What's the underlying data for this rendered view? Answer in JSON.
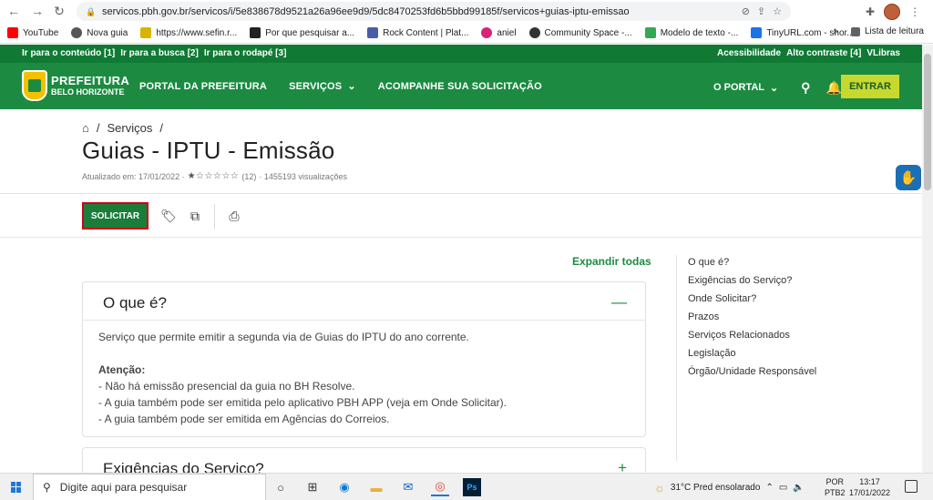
{
  "browser": {
    "url": "servicos.pbh.gov.br/servicos/i/5e838678d9521a26a96ee9d9/5dc8470253fd6b5bbd99185f/servicos+guias-iptu-emissao",
    "bookmarks": [
      {
        "label": "YouTube",
        "color": "#ff0000"
      },
      {
        "label": "Nova guia",
        "color": "#555555"
      },
      {
        "label": "https://www.sefin.r...",
        "color": "#d9b300"
      },
      {
        "label": "Por que pesquisar a...",
        "color": "#222222"
      },
      {
        "label": "Rock Content | Plat...",
        "color": "#4a5ca8"
      },
      {
        "label": "aniel",
        "color": "#d6247a"
      },
      {
        "label": "Community Space -...",
        "color": "#333333"
      },
      {
        "label": "Modelo de texto -...",
        "color": "#34a853"
      },
      {
        "label": "TinyURL.com - shor...",
        "color": "#1a73e8"
      }
    ],
    "bookmarks_more": "»",
    "reading_list": "Lista de leitura"
  },
  "a11y": {
    "skip_content": "Ir para o conteúdo [1]",
    "skip_search": "Ir para a busca [2]",
    "skip_footer": "Ir para o rodapé [3]",
    "accessibility": "Acessibilidade",
    "contrast": "Alto contraste [4]",
    "vlibras": "VLibras"
  },
  "header": {
    "logo_line1": "PREFEITURA",
    "logo_line2": "BELO HORIZONTE",
    "nav": {
      "portal": "PORTAL DA PREFEITURA",
      "servicos": "SERVIÇOS",
      "acompanhe": "ACOMPANHE SUA SOLICITAÇÃO"
    },
    "o_portal": "O PORTAL",
    "entrar": "ENTRAR"
  },
  "breadcrumb": {
    "services": "Serviços",
    "sep": "/"
  },
  "page": {
    "title": "Guias - IPTU - Emissão",
    "updated": "Atualizado em: 17/01/2022 ·",
    "stars": "★☆☆☆☆☆",
    "reviews": "(12)",
    "views": "· 1455193 visualizações",
    "solicitar": "SOLICITAR",
    "expand_all": "Expandir todas"
  },
  "sections": {
    "oque": {
      "title": "O que é?",
      "toggle": "—",
      "intro": "Serviço que permite emitir a segunda via de Guias do IPTU do ano corrente.",
      "attention_label": "Atenção:",
      "line1": "- Não há emissão presencial da guia no BH Resolve.",
      "line2": "- A guia também pode ser emitida pelo aplicativo PBH APP (veja em Onde Solicitar).",
      "line3": "- A guia também pode ser emitida em Agências do Correios."
    },
    "exigencias": {
      "title": "Exigências do Serviço?",
      "toggle": "+"
    }
  },
  "sidebar": {
    "items": [
      {
        "label": "O que é?"
      },
      {
        "label": "Exigências do Serviço?"
      },
      {
        "label": "Onde Solicitar?"
      },
      {
        "label": "Prazos"
      },
      {
        "label": "Serviços Relacionados"
      },
      {
        "label": "Legislação"
      },
      {
        "label": "Órgão/Unidade Responsável"
      }
    ]
  },
  "taskbar": {
    "search_placeholder": "Digite aqui para pesquisar",
    "weather": "31°C  Pred ensolarado",
    "lang1": "POR",
    "lang2": "PTB2",
    "time": "13:17",
    "date": "17/01/2022"
  }
}
